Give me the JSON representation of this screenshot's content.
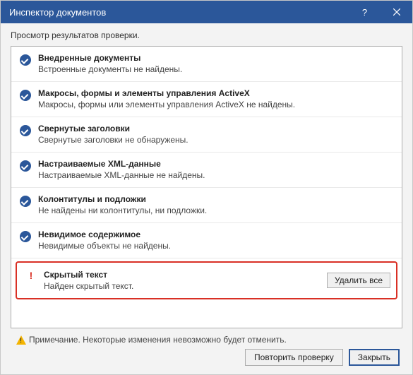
{
  "window": {
    "title": "Инспектор документов"
  },
  "subtitle": "Просмотр результатов проверки.",
  "items": [
    {
      "icon": "check",
      "title": "Внедренные документы",
      "desc": "Встроенные документы не найдены."
    },
    {
      "icon": "check",
      "title": "Макросы, формы и элементы управления ActiveX",
      "desc": "Макросы, формы или элементы управления ActiveX не найдены."
    },
    {
      "icon": "check",
      "title": "Свернутые заголовки",
      "desc": "Свернутые заголовки не обнаружены."
    },
    {
      "icon": "check",
      "title": "Настраиваемые XML-данные",
      "desc": "Настраиваемые XML-данные не найдены."
    },
    {
      "icon": "check",
      "title": "Колонтитулы и подложки",
      "desc": "Не найдены ни колонтитулы, ни подложки."
    },
    {
      "icon": "check",
      "title": "Невидимое содержимое",
      "desc": "Невидимые объекты не найдены."
    },
    {
      "icon": "excl",
      "title": "Скрытый текст",
      "desc": "Найден скрытый текст.",
      "action": "Удалить все",
      "highlight": true
    }
  ],
  "footer": {
    "note": "Примечание. Некоторые изменения невозможно будет отменить.",
    "reinspect": "Повторить проверку",
    "close": "Закрыть"
  }
}
